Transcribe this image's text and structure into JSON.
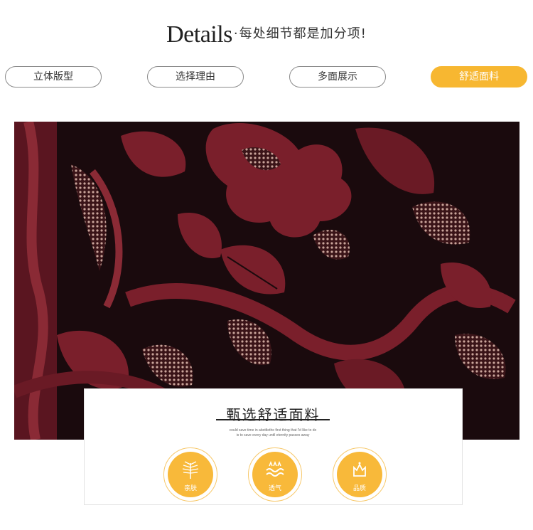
{
  "header": {
    "title_en": "Details",
    "separator": "·",
    "title_cn": "每处细节都是加分项!"
  },
  "tabs": [
    {
      "label": "立体版型",
      "active": false
    },
    {
      "label": "选择理由",
      "active": false
    },
    {
      "label": "多面展示",
      "active": false
    },
    {
      "label": "舒适面料",
      "active": true
    }
  ],
  "colors": {
    "accent": "#f7b731",
    "fabric_base": "#1a0a0d",
    "fabric_pattern": "#7a1f2b"
  },
  "feature_card": {
    "heading": "甄选舒适面料",
    "sub_line1": "could save time in abottlethe first thing that I'd like to do",
    "sub_line2": "is to save every day until eternity passes away",
    "features": [
      {
        "label": "亲肤",
        "icon": "leaf-icon"
      },
      {
        "label": "透气",
        "icon": "wave-icon"
      },
      {
        "label": "品质",
        "icon": "crown-icon"
      }
    ]
  }
}
